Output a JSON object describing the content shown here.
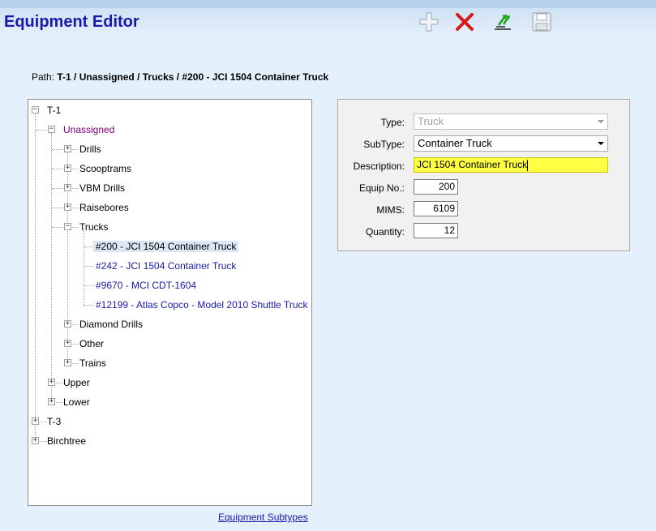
{
  "app": {
    "title": "Equipment Editor"
  },
  "toolbar": {
    "buttons": [
      {
        "name": "add",
        "icon": "plus-icon"
      },
      {
        "name": "delete",
        "icon": "delete-x-icon"
      },
      {
        "name": "move",
        "icon": "move-arrows-icon"
      },
      {
        "name": "save",
        "icon": "save-disk-icon"
      }
    ]
  },
  "path": {
    "label": "Path:",
    "value": "T-1 / Unassigned / Trucks / #200 - JCI 1504 Container Truck"
  },
  "tree": {
    "t1": "T-1",
    "unassigned": "Unassigned",
    "drills": "Drills",
    "scooptrams": "Scooptrams",
    "vbm_drills": "VBM Drills",
    "raisebores": "Raisebores",
    "trucks": "Trucks",
    "truck_items": [
      "#200 - JCI 1504 Container Truck",
      "#242 - JCI 1504 Container Truck",
      "#9670 - MCI CDT-1604",
      "#12199 - Atlas Copco - Model 2010 Shuttle Truck"
    ],
    "diamond_drills": "Diamond Drills",
    "other": "Other",
    "trains": "Trains",
    "upper": "Upper",
    "lower": "Lower",
    "t3": "T-3",
    "birchtree": "Birchtree"
  },
  "form": {
    "type_label": "Type:",
    "type_value": "Truck",
    "subtype_label": "SubType:",
    "subtype_value": "Container Truck",
    "description_label": "Description:",
    "description_value": "JCI 1504 Container Truck",
    "equip_no_label": "Equip No.:",
    "equip_no_value": "200",
    "mims_label": "MIMS:",
    "mims_value": "6109",
    "quantity_label": "Quantity:",
    "quantity_value": "12"
  },
  "footer": {
    "link": "Equipment Subtypes"
  },
  "colors": {
    "title": "#1a1aa8",
    "highlight": "#ffff44",
    "selected_bg": "#dde6f5",
    "link": "#1a1aa8"
  }
}
